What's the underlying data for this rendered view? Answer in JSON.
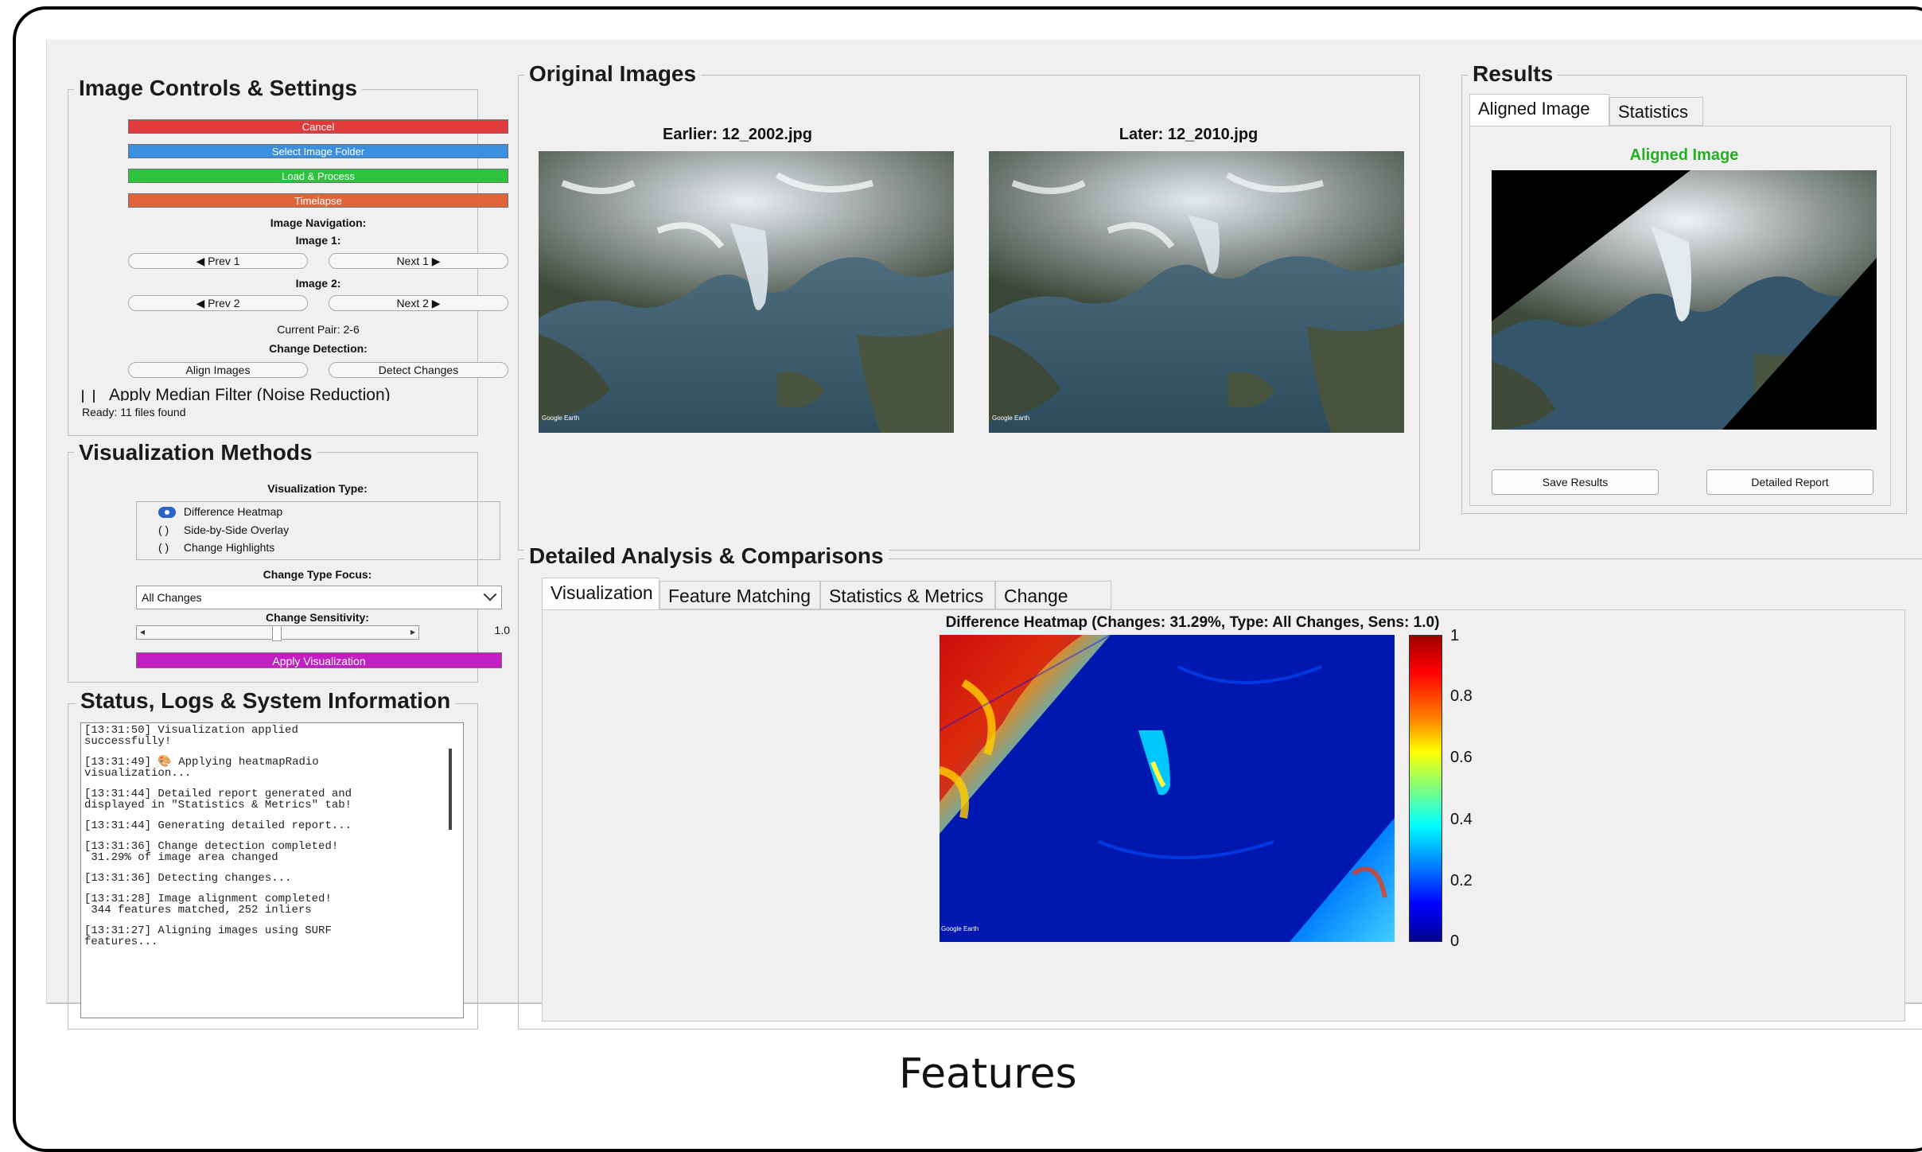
{
  "controls": {
    "title": "Image Controls & Settings",
    "cancel_label": "Cancel",
    "select_folder_label": "Select Image Folder",
    "load_process_label": "Load & Process",
    "timelapse_label": "Timelapse",
    "nav_label": "Image Navigation:",
    "image1_label": "Image 1:",
    "prev1_label": "◀ Prev 1",
    "next1_label": "Next 1 ▶",
    "image2_label": "Image 2:",
    "prev2_label": "◀ Prev 2",
    "next2_label": "Next 2 ▶",
    "current_pair": "Current Pair: 2-6",
    "change_detection_label": "Change Detection:",
    "align_label": "Align Images",
    "detect_label": "Detect Changes",
    "median_filter_label": "Apply Median Filter (Noise Reduction)",
    "median_filter_checked": false,
    "ready_text": "Ready: 11 files found",
    "colors": {
      "cancel": "#e03a3a",
      "select": "#3a8fe0",
      "load": "#2fc23f",
      "timelapse": "#e0663a"
    }
  },
  "visualization": {
    "title": "Visualization Methods",
    "type_label": "Visualization Type:",
    "options": [
      "Difference Heatmap",
      "Side-by-Side Overlay",
      "Change Highlights"
    ],
    "selected_index": 0,
    "focus_label": "Change Type Focus:",
    "focus_value": "All Changes",
    "sensitivity_label": "Change Sensitivity:",
    "sensitivity_value": "1.0",
    "slider_fraction": 0.5,
    "apply_label": "Apply Visualization",
    "apply_color": "#c21fc2"
  },
  "status": {
    "title": "Status, Logs & System Information",
    "logs": [
      "[13:31:50] Visualization applied\nsuccessfully!",
      "[13:31:49] 🎨 Applying heatmapRadio\nvisualization...",
      "[13:31:44] Detailed report generated and\ndisplayed in \"Statistics & Metrics\" tab!",
      "[13:31:44] Generating detailed report...",
      "[13:31:36] Change detection completed!\n 31.29% of image area changed",
      "[13:31:36] Detecting changes...",
      "[13:31:28] Image alignment completed!\n 344 features matched, 252 inliers",
      "[13:31:27] Aligning images using SURF\nfeatures..."
    ]
  },
  "original": {
    "title": "Original Images",
    "earlier_caption": "Earlier: 12_2002.jpg",
    "later_caption": "Later: 12_2010.jpg",
    "watermark": "Google Earth"
  },
  "results": {
    "title": "Results",
    "tabs": [
      "Aligned Image",
      "Statistics"
    ],
    "aligned_caption": "Aligned Image",
    "aligned_caption_color": "#22b022",
    "save_label": "Save Results",
    "report_label": "Detailed Report"
  },
  "analysis": {
    "title": "Detailed Analysis & Comparisons",
    "tabs": [
      "Visualization",
      "Feature Matching",
      "Statistics & Metrics",
      "Change Map"
    ],
    "heatmap_title": "Difference Heatmap (Changes: 31.29%, Type: All Changes, Sens: 1.0)",
    "colorbar_ticks": [
      "1",
      "0.8",
      "0.6",
      "0.4",
      "0.2",
      "0"
    ],
    "watermark": "Google Earth"
  },
  "footer": {
    "caption": "Features"
  }
}
